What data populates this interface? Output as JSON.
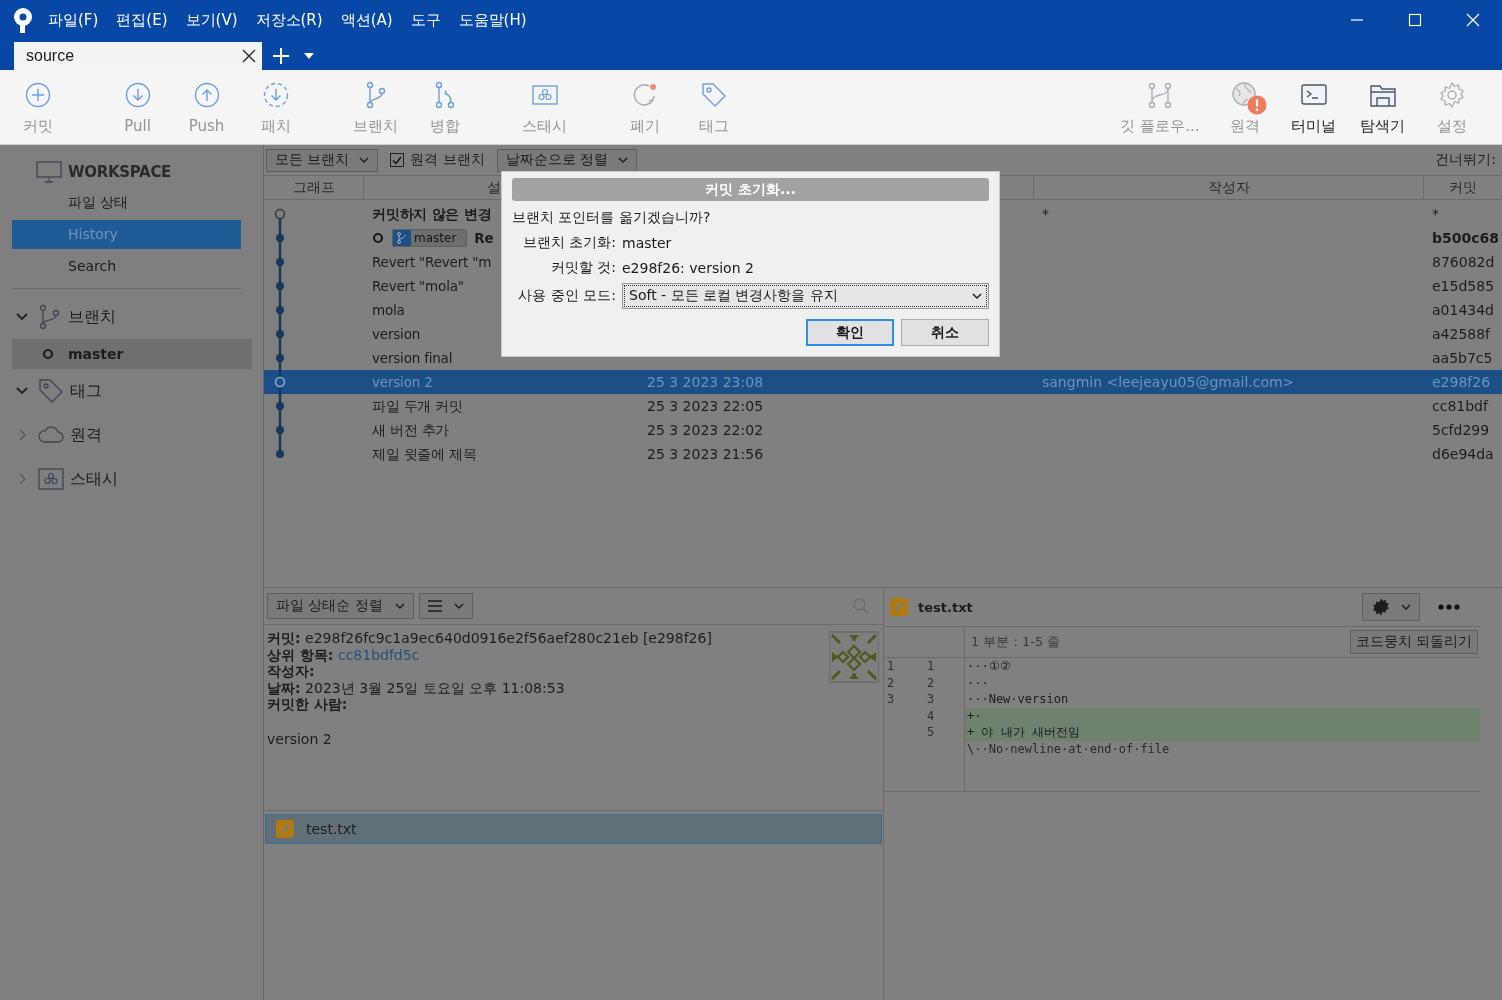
{
  "window": {
    "menu": [
      "파일(F)",
      "편집(E)",
      "보기(V)",
      "저장소(R)",
      "액션(A)",
      "도구",
      "도움말(H)"
    ],
    "tabs": [
      {
        "label": "source",
        "selected": true
      }
    ]
  },
  "toolbar": {
    "left": [
      [
        {
          "kind": "commit",
          "label": "커밋",
          "disabled": true
        }
      ],
      [
        {
          "kind": "pull",
          "label": "Pull",
          "disabled": true
        },
        {
          "kind": "push",
          "label": "Push",
          "disabled": true
        },
        {
          "kind": "fetch",
          "label": "패치",
          "disabled": true
        }
      ],
      [
        {
          "kind": "branch",
          "label": "브랜치",
          "disabled": true
        },
        {
          "kind": "merge",
          "label": "병합",
          "disabled": true
        }
      ],
      [
        {
          "kind": "stash",
          "label": "스태시",
          "disabled": true
        }
      ],
      [
        {
          "kind": "discard",
          "label": "폐기",
          "disabled": true
        },
        {
          "kind": "tag",
          "label": "태그",
          "disabled": true
        }
      ]
    ],
    "right": [
      [
        {
          "kind": "gitflow",
          "label": "깃 플로우...",
          "disabled": true
        }
      ],
      [
        {
          "kind": "remote",
          "label": "원격",
          "disabled": true,
          "alert": true
        },
        {
          "kind": "terminal",
          "label": "터미널",
          "disabled": false
        },
        {
          "kind": "explorer",
          "label": "탐색기",
          "disabled": false
        },
        {
          "kind": "settings",
          "label": "설정",
          "disabled": true
        }
      ]
    ]
  },
  "sidebar": {
    "workspace": {
      "title": "WORKSPACE",
      "items": [
        {
          "label": "파일 상태",
          "selected": false
        },
        {
          "label": "History",
          "selected": true
        },
        {
          "label": "Search",
          "selected": false
        }
      ]
    },
    "sections": [
      {
        "kind": "branch",
        "label": "브랜치",
        "expanded": true,
        "children": [
          {
            "label": "master",
            "selected": true
          }
        ]
      },
      {
        "kind": "tag",
        "label": "태그",
        "expanded": true
      },
      {
        "kind": "remote",
        "label": "원격",
        "expanded": false
      },
      {
        "kind": "stash",
        "label": "스태시",
        "expanded": false
      }
    ]
  },
  "history": {
    "branch_filter": "모든 브랜치",
    "remote_branches": {
      "label": "원격 브랜치",
      "checked": true
    },
    "sort": "날짜순으로 정렬",
    "jump": "건너뛰기:",
    "columns": [
      "그래프",
      "설",
      "작성자",
      "커밋"
    ],
    "rows": [
      {
        "kind": "working",
        "description": "커밋하지 않은 변경",
        "bold": true,
        "author": "*",
        "commit": "*",
        "selected": false
      },
      {
        "kind": "commit",
        "badge": "master",
        "description": "Re",
        "commit": "b500c68",
        "head": true,
        "selected": false
      },
      {
        "kind": "commit",
        "description": "Revert \"Revert \"m",
        "commit": "876082d",
        "selected": false
      },
      {
        "kind": "commit",
        "description": "Revert \"mola\"",
        "commit": "e15d585",
        "selected": false
      },
      {
        "kind": "commit",
        "description": "mola",
        "commit": "a01434d",
        "selected": false
      },
      {
        "kind": "commit",
        "description": "version",
        "commit": "a42588f",
        "selected": false
      },
      {
        "kind": "commit",
        "description": "version final",
        "commit": "aa5b7c5",
        "selected": false
      },
      {
        "kind": "checkout",
        "description": "version 2",
        "date": "25 3 2023 23:08",
        "author": "sangmin <leejeayu05@gmail.com>",
        "commit": "e298f26",
        "selected": true
      },
      {
        "kind": "commit",
        "description": "파일 두개 커밋",
        "date": "25 3 2023 22:05",
        "commit": "cc81bdf",
        "selected": false
      },
      {
        "kind": "commit",
        "description": "새 버전 추가",
        "date": "25 3 2023 22:02",
        "commit": "5cfd299",
        "selected": false
      },
      {
        "kind": "commit",
        "description": "제일 윗줄에 제목",
        "date": "25 3 2023 21:56",
        "commit": "d6e94da",
        "selected": false
      }
    ]
  },
  "details": {
    "sort": "파일 상태순 정렬",
    "fields": [
      {
        "label": "커밋:",
        "value": "e298f26fc9c1a9ec640d0916e2f56aef280c21eb [e298f26]"
      },
      {
        "label": "상위 항목:",
        "value": "cc81bdfd5c",
        "kind": "link"
      },
      {
        "label": "작성자:"
      },
      {
        "label": "날짜:",
        "value": "2023년 3월 25일 토요일 오후 11:08:53"
      },
      {
        "label": "커밋한 사람:"
      }
    ],
    "message": "version 2",
    "files": [
      {
        "name": "test.txt",
        "selected": true
      }
    ]
  },
  "diff": {
    "file": "test.txt",
    "hunk": "1 부분 : 1-5 줄",
    "revert_button": "코드뭉치 되돌리기",
    "lines": [
      {
        "kind": "context",
        "old": "1",
        "new": "1",
        "text": "···①②"
      },
      {
        "kind": "context",
        "old": "2",
        "new": "2",
        "text": "···"
      },
      {
        "kind": "context",
        "old": "3",
        "new": "3",
        "text": "···New·version"
      },
      {
        "kind": "added",
        "new": "4",
        "text": "+·"
      },
      {
        "kind": "added",
        "new": "5",
        "text": "+ 야 내가 새버전임"
      },
      {
        "kind": "meta",
        "text": "\\··No·newline·at·end·of·file"
      }
    ]
  },
  "dialog": {
    "title": "커밋 초기화...",
    "question": "브랜치 포인터를 옮기겠습니까?",
    "fields": [
      {
        "label": "브랜치 초기화:",
        "value": "master"
      },
      {
        "label": "커밋할 것:",
        "value": "e298f26: version 2"
      }
    ],
    "mode": {
      "label": "사용 중인 모드:",
      "value": "Soft - 모든 로컬 변경사항을 유지"
    },
    "buttons": [
      {
        "label": "확인",
        "default": true
      },
      {
        "label": "취소",
        "default": false
      }
    ]
  }
}
